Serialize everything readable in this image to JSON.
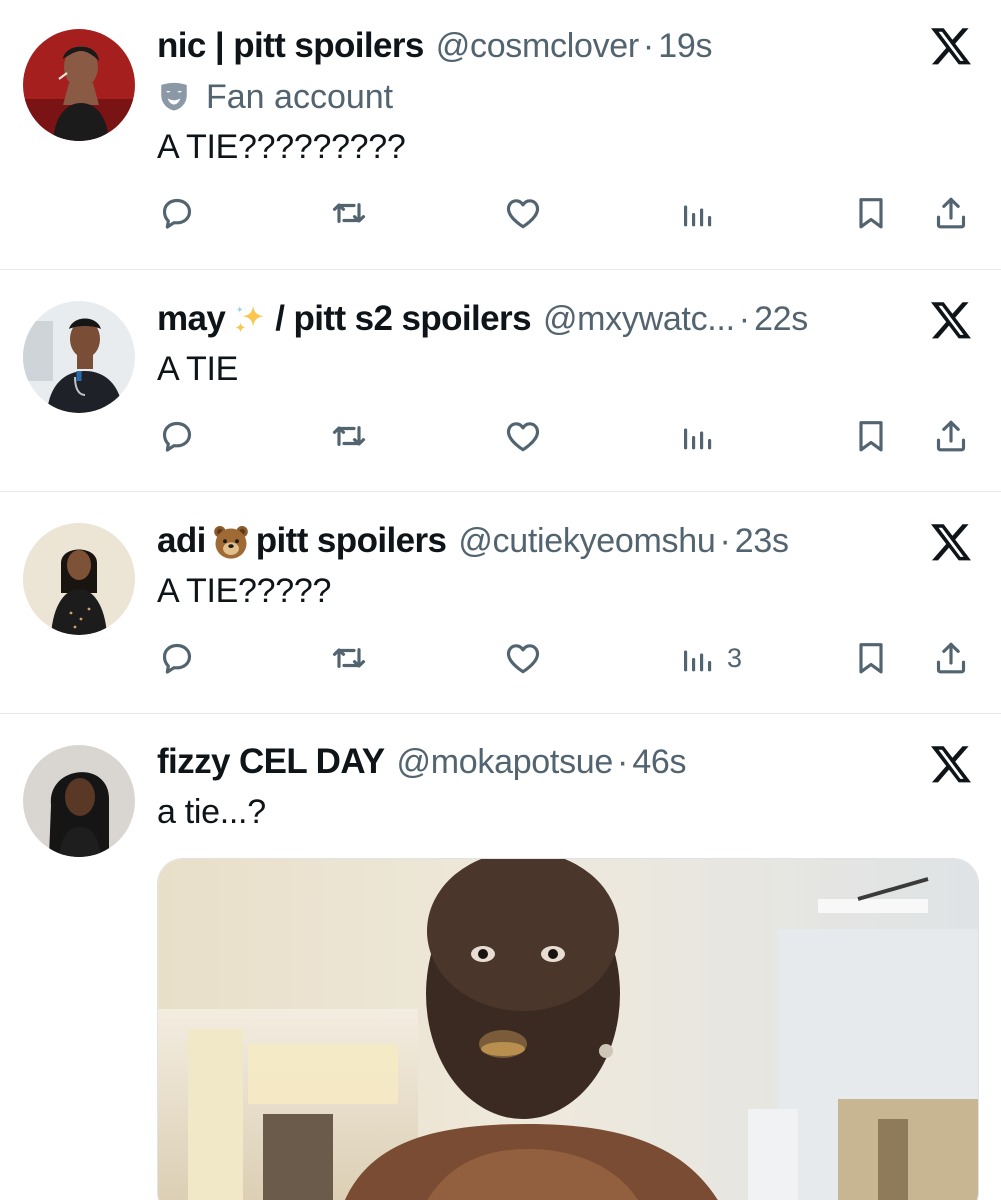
{
  "posts": [
    {
      "display_name": "nic | pitt spoilers",
      "handle": "@cosmclover",
      "separator": "·",
      "time": "19s",
      "badge": "Fan account",
      "text": "A TIE?????????",
      "views": ""
    },
    {
      "display_name_before": "may",
      "display_name_emoji": "sparkles-emoji",
      "display_name_after": "/ pitt s2 spoilers",
      "handle": "@mxywatc...",
      "separator": "·",
      "time": "22s",
      "text": "A TIE",
      "views": ""
    },
    {
      "display_name_before": "adi",
      "display_name_emoji": "bear-emoji",
      "display_name_after": "pitt spoilers",
      "handle": "@cutiekyeomshu",
      "separator": "·",
      "time": "23s",
      "text": "A TIE?????",
      "views": "3"
    },
    {
      "display_name": "fizzy CEL DAY",
      "handle": "@mokapotsue",
      "separator": "·",
      "time": "46s",
      "text": "a tie...?",
      "media": "photo of a person with a surprised expression in an office"
    }
  ],
  "icons": {
    "reply": "reply-icon",
    "repost": "repost-icon",
    "like": "like-icon",
    "views": "views-icon",
    "bookmark": "bookmark-icon",
    "share": "share-icon",
    "platform": "x-logo-icon",
    "badge": "theater-mask-icon"
  },
  "colors": {
    "text": "#0f1419",
    "secondary": "#536471",
    "divider": "#e6e9ec",
    "badge": "#8b98a5"
  }
}
